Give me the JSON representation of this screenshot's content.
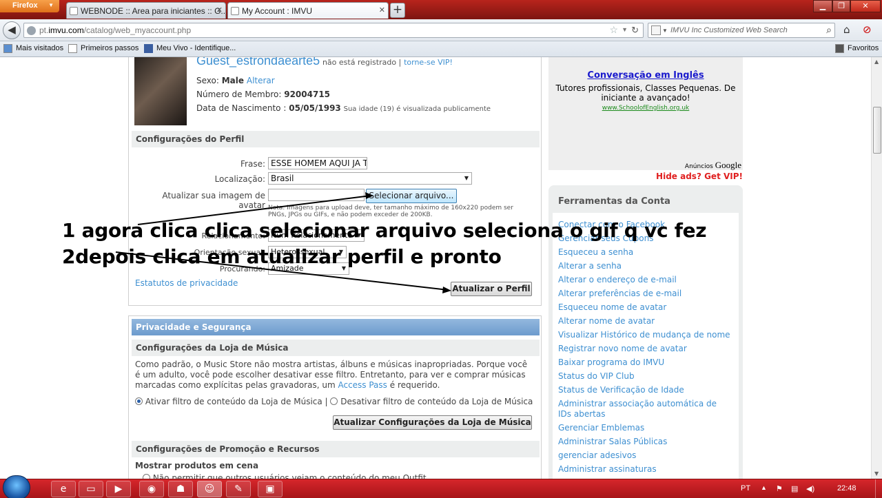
{
  "browser": {
    "menu_button": "Firefox",
    "tabs": [
      {
        "label": "WEBNODE :: Area para iniciantes :: G...",
        "active": false
      },
      {
        "label": "My Account : IMVU",
        "active": true
      }
    ],
    "new_tab": "+",
    "url_prefix": "pt.",
    "url_domain": "imvu.com",
    "url_path": "/catalog/web_myaccount.php",
    "search_placeholder": "IMVU Inc Customized Web Search",
    "bookmarks": [
      "Mais visitados",
      "Primeiros passos",
      "Meu Vivo - Identifique...",
      "Favoritos"
    ]
  },
  "profile": {
    "username": "Guest_estrondaearte5",
    "not_registered": "não está registrado |",
    "vip_link": "torne-se VIP!",
    "sex_label": "Sexo:",
    "sex_value": "Male",
    "sex_change": "Alterar",
    "member_label": "Número de Membro:",
    "member_value": "92004715",
    "birth_label": "Data de Nascimento :",
    "birth_value": "05/05/1993",
    "birth_note": "Sua idade (19) é visualizada publicamente"
  },
  "profile_settings": {
    "heading": "Configurações do Perfil",
    "phrase_label": "Frase:",
    "phrase_value": "ESSE HOMEM AQUI JA T",
    "location_label": "Localização:",
    "location_value": "Brasil",
    "avatar_label": "Atualizar sua imagem de avatar",
    "choose_file": "Selecionar arquivo...",
    "upload_note": "Nota: Imagens para upload deve, ter tamanho máximo de 160x220 podem ser PNGs, JPGs ou GIFs, e não podem exceder de 200KB.",
    "relationship_label": "Relacionamento:",
    "relationship_value": "Num Relacionamento",
    "orientation_label": "Orientação sexual:",
    "orientation_value": "Heterossexual",
    "seeking_label": "Procurando:",
    "seeking_value": "Amizade",
    "privacy_link": "Estatutos de privacidade",
    "update_button": "Atualizar o Perfil"
  },
  "privacy": {
    "heading": "Privacidade e Segurança",
    "music_heading": "Configurações da Loja de Música",
    "music_text_1": "Como padrão, o Music Store não mostra artistas, álbuns e músicas inapropriadas. Porque você é um adulto, você pode escolher desativar esse filtro. Entretanto, para ver e comprar músicas marcadas como explícitas pelas gravadoras, um",
    "music_access_pass": "Access Pass",
    "music_text_2": "é requerido.",
    "radio_on": "Ativar filtro de conteúdo da Loja de Música |",
    "radio_off": "Desativar filtro de conteúdo da Loja de Música",
    "music_button": "Atualizar Configurações da Loja de Música",
    "promo_heading": "Configurações de Promoção e Recursos",
    "show_products": "Mostrar produtos em cena",
    "no_allow": "Não permitir que outros usuários vejam o conteúdo do meu Outfit"
  },
  "ad": {
    "title": "Conversação em Inglês",
    "body": "Tutores profissionais, Classes Pequenas. De iniciante a avançado!",
    "url": "www.SchoolofEnglish.org.uk",
    "ads_by": "Anúncios",
    "google": "Google",
    "hide_ads": "Hide ads? Get VIP!"
  },
  "account_tools": {
    "heading": "Ferramentas da Conta",
    "items": [
      "Conectar com o Facebook",
      "Gerenciar seus Cupons",
      "Esqueceu a senha",
      "Alterar a senha",
      "Alterar o endereço de e-mail",
      "Alterar preferências de e-mail",
      "Esqueceu nome de avatar",
      "Alterar nome de avatar",
      "Visualizar Histórico de mudança de nome",
      "Registrar novo nome de avatar",
      "Baixar programa do IMVU",
      "Status do VIP Club",
      "Status de Verificação de Idade",
      "Administrar associação automática de IDs abertas",
      "Gerenciar Emblemas",
      "Administrar Salas Públicas",
      "gerenciar adesivos",
      "Administrar assinaturas"
    ]
  },
  "annotation": {
    "line1": "1 agora clica clica selecionar arquivo seleciona o gif q vc fez",
    "line2": "2depois clica em atualizar perfil e pronto"
  },
  "taskbar": {
    "lang": "PT",
    "time": "22:48"
  }
}
